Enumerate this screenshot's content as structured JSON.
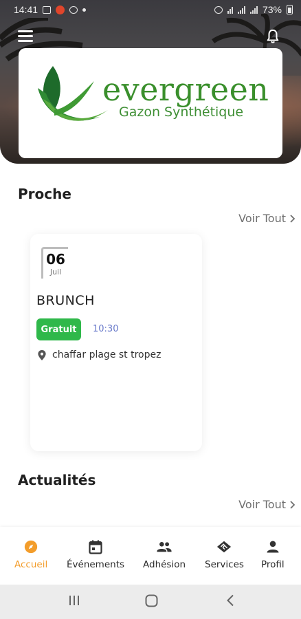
{
  "status_bar": {
    "time": "14:41",
    "battery": "73%"
  },
  "brand": {
    "name": "evergreen",
    "tagline": "Gazon Synthétique",
    "color": "#3a8f2c"
  },
  "sections": {
    "nearby": {
      "title": "Proche",
      "see_all": "Voir Tout"
    },
    "news": {
      "title": "Actualités",
      "see_all": "Voir Tout"
    }
  },
  "event": {
    "day": "06",
    "month": "Juil",
    "title": "BRUNCH",
    "price_badge": "Gratuit",
    "time": "10:30",
    "location": "chaffar plage st tropez"
  },
  "bottom_nav": {
    "items": [
      {
        "label": "Accueil",
        "icon": "compass-icon",
        "active": true
      },
      {
        "label": "Événements",
        "icon": "calendar-icon",
        "active": false
      },
      {
        "label": "Adhésion",
        "icon": "people-icon",
        "active": false
      },
      {
        "label": "Services",
        "icon": "handshake-icon",
        "active": false
      },
      {
        "label": "Profil",
        "icon": "person-icon",
        "active": false
      }
    ],
    "active_color": "#f39d2b"
  },
  "icons": {
    "menu": "menu-icon",
    "bell": "bell-icon",
    "location": "location-pin-icon"
  }
}
